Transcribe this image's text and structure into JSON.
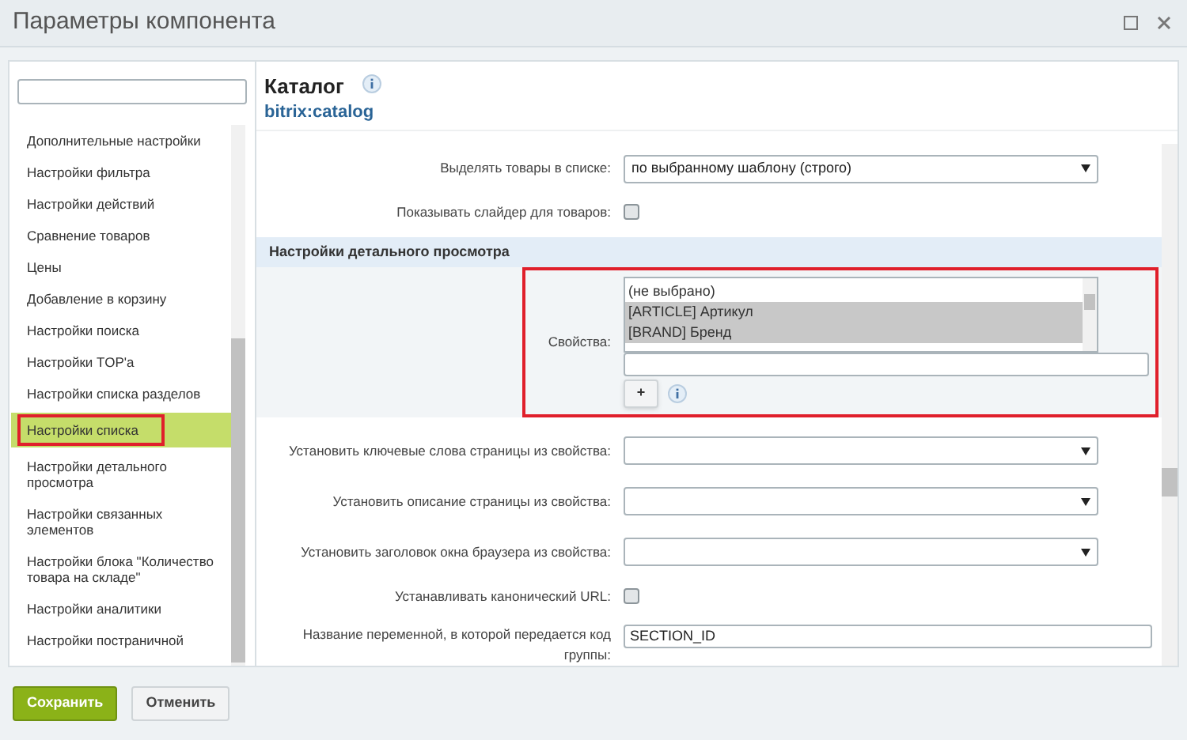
{
  "window": {
    "title": "Параметры компонента"
  },
  "sidebar": {
    "items": [
      {
        "label": "Дополнительные настройки",
        "selected": false
      },
      {
        "label": "Настройки фильтра",
        "selected": false
      },
      {
        "label": "Настройки действий",
        "selected": false
      },
      {
        "label": "Сравнение товаров",
        "selected": false
      },
      {
        "label": "Цены",
        "selected": false
      },
      {
        "label": "Добавление в корзину",
        "selected": false
      },
      {
        "label": "Настройки поиска",
        "selected": false
      },
      {
        "label": "Настройки TOP'а",
        "selected": false
      },
      {
        "label": "Настройки списка разделов",
        "selected": false
      },
      {
        "label": "Настройки списка",
        "selected": true
      },
      {
        "label": "Настройки детального просмотра",
        "selected": false
      },
      {
        "label": "Настройки связанных элементов",
        "selected": false
      },
      {
        "label": "Настройки блока \"Количество товара на складе\"",
        "selected": false
      },
      {
        "label": "Настройки аналитики",
        "selected": false
      },
      {
        "label": "Настройки постраничной",
        "selected": false
      }
    ]
  },
  "component": {
    "title": "Каталог",
    "code": "bitrix:catalog"
  },
  "rows": [
    {
      "kind": "select",
      "label": "Выделять товары в списке:",
      "value": "по выбранному шаблону (строго)"
    },
    {
      "kind": "checkbox",
      "label": "Показывать слайдер для товаров:",
      "checked": false
    },
    {
      "kind": "section",
      "label": "Настройки детального просмотра"
    },
    {
      "kind": "multiselect",
      "label": "Свойства:",
      "highlighted": true,
      "options": [
        {
          "label": "(не выбрано)",
          "selected": false
        },
        {
          "label": "[ARTICLE] Артикул",
          "selected": true
        },
        {
          "label": "[BRAND] Бренд",
          "selected": true
        }
      ],
      "add_label": "+"
    },
    {
      "kind": "select",
      "label": "Установить ключевые слова страницы из свойства:",
      "value": ""
    },
    {
      "kind": "select",
      "label": "Установить описание страницы из свойства:",
      "value": ""
    },
    {
      "kind": "select",
      "label": "Установить заголовок окна браузера из свойства:",
      "value": ""
    },
    {
      "kind": "checkbox",
      "label": "Устанавливать канонический URL:",
      "checked": false
    },
    {
      "kind": "text",
      "label": "Название переменной, в которой передается код группы:",
      "value": "SECTION_ID"
    }
  ],
  "buttons": [
    {
      "label": "Сохранить",
      "kind": "primary"
    },
    {
      "label": "Отменить",
      "kind": "secondary"
    }
  ]
}
